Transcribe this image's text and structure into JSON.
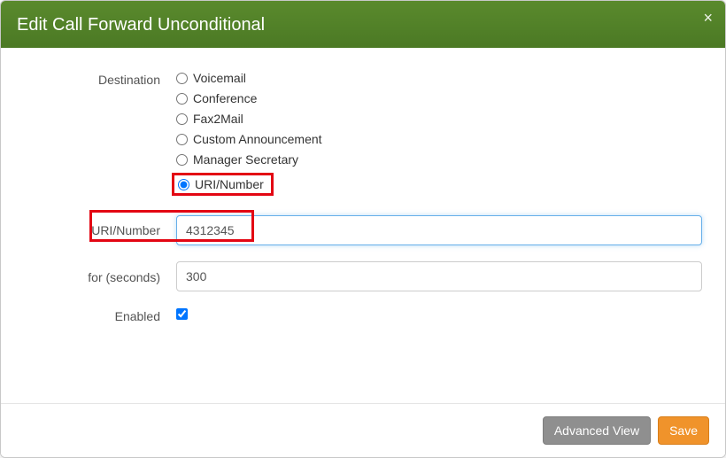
{
  "header": {
    "title": "Edit Call Forward Unconditional",
    "close": "×"
  },
  "form": {
    "destination_label": "Destination",
    "destination_options": {
      "voicemail": "Voicemail",
      "conference": "Conference",
      "fax2mail": "Fax2Mail",
      "custom_announcement": "Custom Announcement",
      "manager_secretary": "Manager Secretary",
      "uri_number": "URI/Number"
    },
    "uri_number_label": "URI/Number",
    "uri_number_value": "4312345",
    "for_seconds_label": "for (seconds)",
    "for_seconds_value": "300",
    "enabled_label": "Enabled",
    "enabled_checked": true
  },
  "footer": {
    "advanced_view": "Advanced View",
    "save": "Save"
  }
}
